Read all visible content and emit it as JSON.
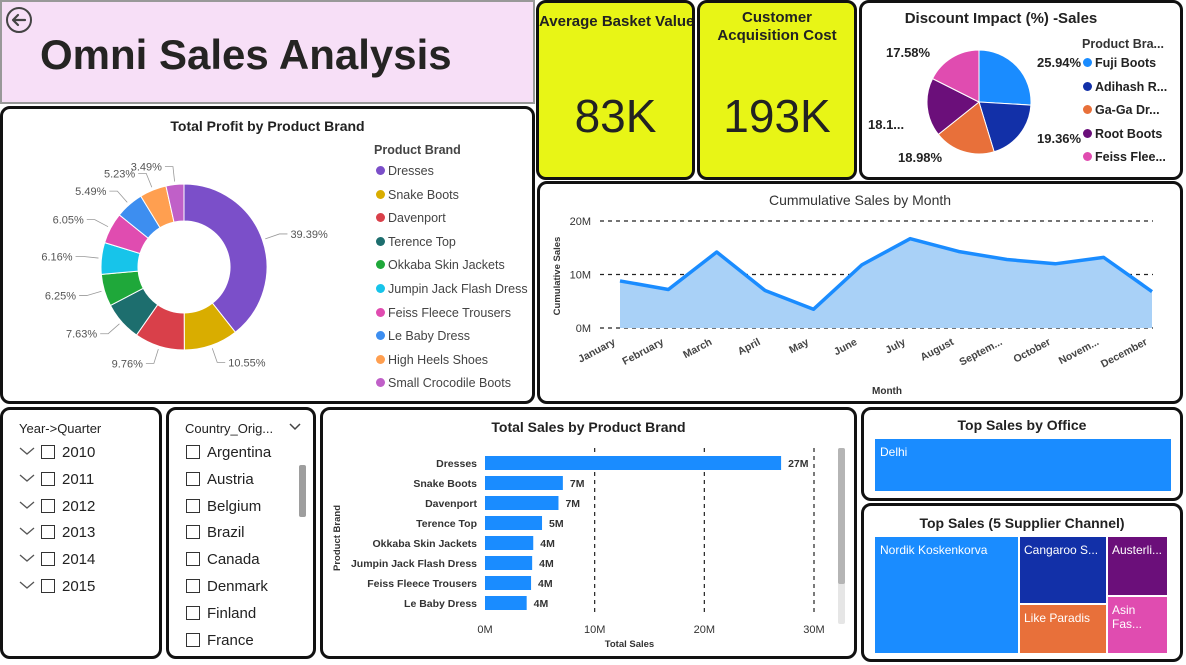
{
  "header": {
    "title": "Omni Sales Analysis",
    "back_icon": "back-arrow-icon"
  },
  "kpis": {
    "basket": {
      "title": "Average Basket Value",
      "value": "83K"
    },
    "cac": {
      "title_line1": "Customer",
      "title_line2": "Acquisition Cost",
      "value": "193K"
    }
  },
  "discount": {
    "title": "Discount Impact (%) -Sales",
    "legend_title": "Product Bra...",
    "legend": [
      "Fuji Boots",
      "Adihash R...",
      "Ga-Ga Dr...",
      "Root Boots",
      "Feiss Flee..."
    ],
    "labels": [
      "25.94%",
      "19.36%",
      "18.98%",
      "18.1...",
      "17.58%"
    ]
  },
  "profit": {
    "title": "Total Profit by Product Brand",
    "legend_title": "Product Brand",
    "legend": [
      "Dresses",
      "Snake Boots",
      "Davenport",
      "Terence Top",
      "Okkaba Skin Jackets",
      "Jumpin Jack Flash Dress",
      "Feiss Fleece Trousers",
      "Le Baby Dress",
      "High Heels Shoes",
      "Small Crocodile Boots"
    ],
    "labels": [
      "39.39%",
      "10.55%",
      "9.76%",
      "7.63%",
      "6.25%",
      "6.16%",
      "6.05%",
      "5.49%",
      "5.23%",
      "3.49%"
    ]
  },
  "cumulative": {
    "title": "Cummulative Sales by Month",
    "ylabel": "Cumulative Sales",
    "xlabel": "Month",
    "yticks": [
      "20M",
      "10M",
      "0M"
    ],
    "months": [
      "January",
      "February",
      "March",
      "April",
      "May",
      "June",
      "July",
      "August",
      "Septem...",
      "October",
      "Novem...",
      "December"
    ]
  },
  "year_slicer": {
    "title": "Year->Quarter",
    "years": [
      "2010",
      "2011",
      "2012",
      "2013",
      "2014",
      "2015"
    ]
  },
  "country_slicer": {
    "title": "Country_Orig...",
    "countries": [
      "Argentina",
      "Austria",
      "Belgium",
      "Brazil",
      "Canada",
      "Denmark",
      "Finland",
      "France"
    ]
  },
  "sales_by_brand": {
    "title": "Total Sales by Product Brand",
    "ylabel": "Product Brand",
    "xlabel": "Total Sales",
    "xticks": [
      "0M",
      "10M",
      "20M",
      "30M"
    ],
    "categories": [
      "Dresses",
      "Snake Boots",
      "Davenport",
      "Terence Top",
      "Okkaba Skin Jackets",
      "Jumpin Jack Flash Dress",
      "Feiss Fleece Trousers",
      "Le Baby Dress"
    ],
    "value_labels": [
      "27M",
      "7M",
      "7M",
      "5M",
      "4M",
      "4M",
      "4M",
      "4M"
    ]
  },
  "office": {
    "title": "Top Sales by Office",
    "item": "Delhi"
  },
  "supplier": {
    "title": "Top Sales (5 Supplier Channel)",
    "items": [
      "Nordik Koskenkorva",
      "Cangaroo S...",
      "Austerli...",
      "Like Paradis",
      "Asin Fas..."
    ]
  },
  "chart_data": [
    {
      "type": "pie",
      "title": "Discount Impact (%) -Sales",
      "legend_title": "Product Bra...",
      "categories": [
        "Fuji Boots",
        "Adihash R...",
        "Ga-Ga Dr...",
        "Root Boots",
        "Feiss Flee..."
      ],
      "values": [
        25.94,
        19.36,
        18.98,
        18.14,
        17.58
      ],
      "colors": [
        "#1a8cff",
        "#1230a8",
        "#e8703a",
        "#6b0f7a",
        "#e04cb0"
      ]
    },
    {
      "type": "pie",
      "title": "Total Profit by Product Brand",
      "legend_title": "Product Brand",
      "categories": [
        "Dresses",
        "Snake Boots",
        "Davenport",
        "Terence Top",
        "Okkaba Skin Jackets",
        "Jumpin Jack Flash Dress",
        "Feiss Fleece Trousers",
        "Le Baby Dress",
        "High Heels Shoes",
        "Small Crocodile Boots"
      ],
      "values": [
        39.39,
        10.55,
        9.76,
        7.63,
        6.25,
        6.16,
        6.05,
        5.49,
        5.23,
        3.49
      ],
      "colors": [
        "#7b4fc9",
        "#d9ad00",
        "#d9404a",
        "#1d6e6e",
        "#1fa83a",
        "#17c4ea",
        "#e04cb0",
        "#3d8ef0",
        "#ff9f50",
        "#c060c8"
      ]
    },
    {
      "type": "area",
      "title": "Cummulative Sales by Month",
      "xlabel": "Month",
      "ylabel": "Cumulative Sales",
      "x": [
        "January",
        "February",
        "March",
        "April",
        "May",
        "June",
        "July",
        "August",
        "Septem...",
        "October",
        "Novem...",
        "December"
      ],
      "values": [
        8.8,
        7.2,
        14.2,
        7.0,
        3.5,
        11.8,
        16.7,
        14.3,
        12.8,
        12.0,
        13.2,
        6.8
      ],
      "ylim": [
        0,
        20
      ],
      "grid": true,
      "colors": [
        "#1a8cff",
        "#a9d1f7"
      ]
    },
    {
      "type": "bar",
      "title": "Total Sales by Product Brand",
      "orientation": "horizontal",
      "xlabel": "Total Sales",
      "ylabel": "Product Brand",
      "categories": [
        "Dresses",
        "Snake Boots",
        "Davenport",
        "Terence Top",
        "Okkaba Skin Jackets",
        "Jumpin Jack Flash Dress",
        "Feiss Fleece Trousers",
        "Le Baby Dress"
      ],
      "values": [
        27,
        7.1,
        6.7,
        5.2,
        4.4,
        4.3,
        4.2,
        3.8
      ],
      "xlim": [
        0,
        30
      ],
      "colors": [
        "#1a8cff"
      ]
    }
  ]
}
